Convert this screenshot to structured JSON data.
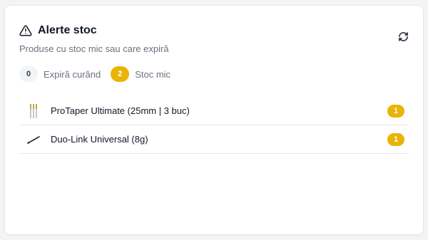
{
  "card": {
    "title": "Alerte stoc",
    "subtitle": "Produse cu stoc mic sau care expiră",
    "title_icon": "warning-triangle-icon",
    "refresh_icon": "refresh-icon"
  },
  "tabs": [
    {
      "count": "0",
      "label": "Expiră curând",
      "style": "gray"
    },
    {
      "count": "2",
      "label": "Stoc mic",
      "style": "amber"
    }
  ],
  "items": [
    {
      "name": "ProTaper Ultimate (25mm | 3 buc)",
      "badge": "1",
      "thumb_icon": "endodontic-files-icon"
    },
    {
      "name": "Duo-Link Universal (8g)",
      "badge": "1",
      "thumb_icon": "applicator-icon"
    }
  ],
  "colors": {
    "accent": "#eab308",
    "text": "#111827",
    "muted": "#6b7280",
    "border": "#e5e7eb"
  }
}
